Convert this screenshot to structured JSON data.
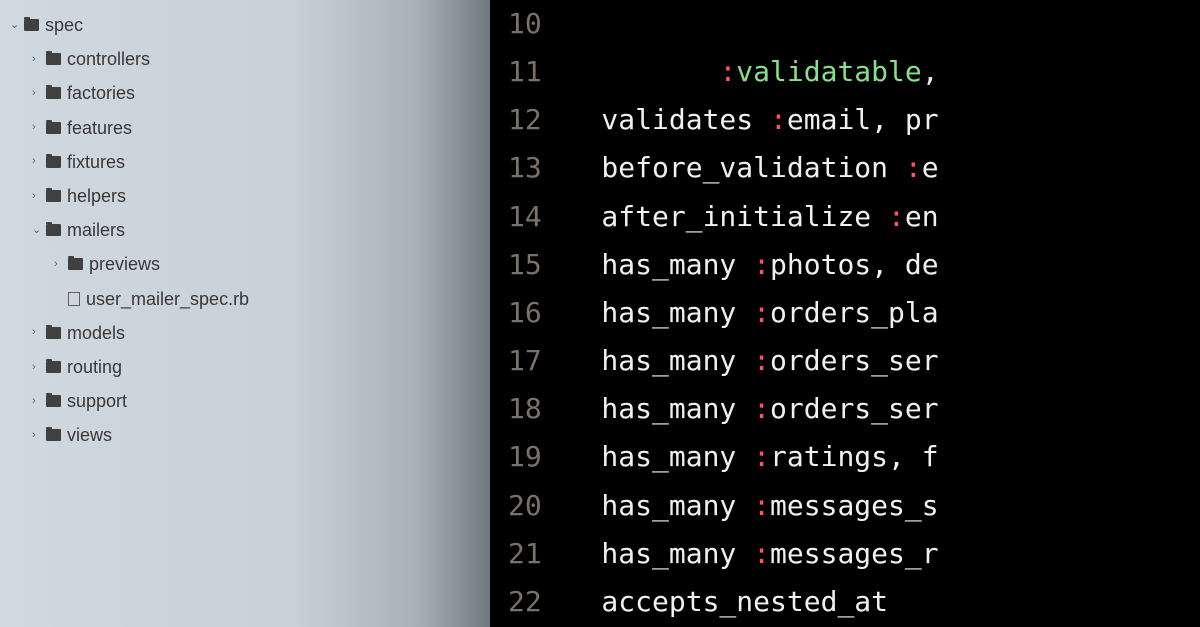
{
  "sidebar": {
    "items": [
      {
        "chevron": "down",
        "icon": "folder",
        "label": "spec",
        "indent": 1
      },
      {
        "chevron": "right",
        "icon": "folder",
        "label": "controllers",
        "indent": 2
      },
      {
        "chevron": "right",
        "icon": "folder",
        "label": "factories",
        "indent": 2
      },
      {
        "chevron": "right",
        "icon": "folder",
        "label": "features",
        "indent": 2
      },
      {
        "chevron": "right",
        "icon": "folder",
        "label": "fixtures",
        "indent": 2
      },
      {
        "chevron": "right",
        "icon": "folder",
        "label": "helpers",
        "indent": 2
      },
      {
        "chevron": "down",
        "icon": "folder",
        "label": "mailers",
        "indent": 2
      },
      {
        "chevron": "right",
        "icon": "folder",
        "label": "previews",
        "indent": 3
      },
      {
        "chevron": "none",
        "icon": "file",
        "label": "user_mailer_spec.rb",
        "indent": 3
      },
      {
        "chevron": "right",
        "icon": "folder",
        "label": "models",
        "indent": 2
      },
      {
        "chevron": "right",
        "icon": "folder",
        "label": "routing",
        "indent": 2
      },
      {
        "chevron": "right",
        "icon": "folder",
        "label": "support",
        "indent": 2
      },
      {
        "chevron": "right",
        "icon": "folder",
        "label": "views",
        "indent": 2
      }
    ]
  },
  "editor": {
    "lineStart": 10,
    "lines": [
      {
        "tokens": []
      },
      {
        "tokens": [
          {
            "t": "         ",
            "c": ""
          },
          {
            "t": ":",
            "c": "t-sym"
          },
          {
            "t": "validatable",
            "c": "t-symg"
          },
          {
            "t": ",",
            "c": "t-punct"
          }
        ]
      },
      {
        "tokens": [
          {
            "t": "  validates ",
            "c": "t-key"
          },
          {
            "t": ":",
            "c": "t-sym"
          },
          {
            "t": "email",
            "c": "t-key"
          },
          {
            "t": ", pr",
            "c": "t-key"
          }
        ]
      },
      {
        "tokens": [
          {
            "t": "  before_validation ",
            "c": "t-key"
          },
          {
            "t": ":",
            "c": "t-sym"
          },
          {
            "t": "e",
            "c": "t-key"
          }
        ]
      },
      {
        "tokens": [
          {
            "t": "  after_initialize ",
            "c": "t-key"
          },
          {
            "t": ":",
            "c": "t-sym"
          },
          {
            "t": "en",
            "c": "t-key"
          }
        ]
      },
      {
        "tokens": [
          {
            "t": "  has_many ",
            "c": "t-key"
          },
          {
            "t": ":",
            "c": "t-sym"
          },
          {
            "t": "photos",
            "c": "t-key"
          },
          {
            "t": ", de",
            "c": "t-key"
          }
        ]
      },
      {
        "tokens": [
          {
            "t": "  has_many ",
            "c": "t-key"
          },
          {
            "t": ":",
            "c": "t-sym"
          },
          {
            "t": "orders_pla",
            "c": "t-key"
          }
        ]
      },
      {
        "tokens": [
          {
            "t": "  has_many ",
            "c": "t-key"
          },
          {
            "t": ":",
            "c": "t-sym"
          },
          {
            "t": "orders_ser",
            "c": "t-key"
          }
        ]
      },
      {
        "tokens": [
          {
            "t": "  has_many ",
            "c": "t-key"
          },
          {
            "t": ":",
            "c": "t-sym"
          },
          {
            "t": "orders_ser",
            "c": "t-key"
          }
        ]
      },
      {
        "tokens": [
          {
            "t": "  has_many ",
            "c": "t-key"
          },
          {
            "t": ":",
            "c": "t-sym"
          },
          {
            "t": "ratings",
            "c": "t-key"
          },
          {
            "t": ", f",
            "c": "t-key"
          }
        ]
      },
      {
        "tokens": [
          {
            "t": "  has_many ",
            "c": "t-key"
          },
          {
            "t": ":",
            "c": "t-sym"
          },
          {
            "t": "messages_s",
            "c": "t-key"
          }
        ]
      },
      {
        "tokens": [
          {
            "t": "  has_many ",
            "c": "t-key"
          },
          {
            "t": ":",
            "c": "t-sym"
          },
          {
            "t": "messages_r",
            "c": "t-key"
          }
        ]
      },
      {
        "tokens": [
          {
            "t": "  accepts_nested_at",
            "c": "t-key"
          }
        ]
      }
    ]
  }
}
